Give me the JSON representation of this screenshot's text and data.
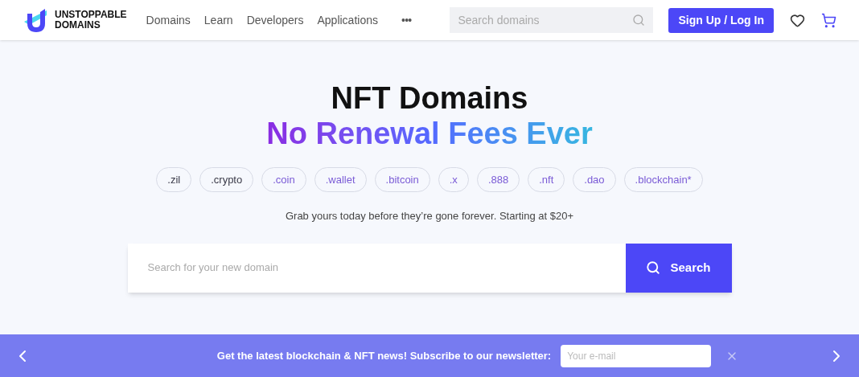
{
  "header": {
    "logo_text": [
      "UNSTOPPABLE",
      "DOMAINS"
    ],
    "nav": [
      "Domains",
      "Learn",
      "Developers",
      "Applications",
      "•••"
    ],
    "search": {
      "placeholder": "Search domains"
    },
    "signup": "Sign Up / Log In"
  },
  "hero": {
    "title": "NFT Domains",
    "subtitle": "No Renewal Fees Ever",
    "chips": [
      {
        "label": ".zil",
        "color": "#3a3a48"
      },
      {
        "label": ".crypto",
        "color": "#3a3a48"
      },
      {
        "label": ".coin",
        "color": "#7a5bd6"
      },
      {
        "label": ".wallet",
        "color": "#7a5bd6"
      },
      {
        "label": ".bitcoin",
        "color": "#7a5bd6"
      },
      {
        "label": ".x",
        "color": "#7a5bd6"
      },
      {
        "label": ".888",
        "color": "#7a5bd6"
      },
      {
        "label": ".nft",
        "color": "#7a5bd6"
      },
      {
        "label": ".dao",
        "color": "#7a5bd6"
      },
      {
        "label": ".blockchain*",
        "color": "#7a5bd6"
      }
    ],
    "tagline": "Grab yours today before they’re gone forever. Starting at $20+",
    "search": {
      "placeholder": "Search for your new domain",
      "button": "Search"
    }
  },
  "banner": {
    "text": "Get the latest blockchain & NFT news! Subscribe to our newsletter:",
    "email_placeholder": "Your e-mail"
  }
}
